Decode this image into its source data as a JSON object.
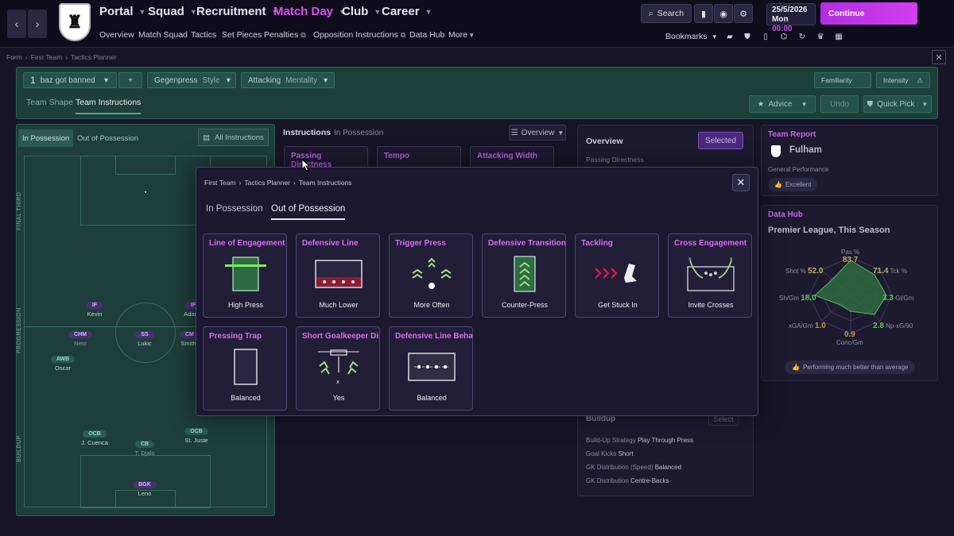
{
  "nav": {
    "menus": [
      {
        "label": "Portal"
      },
      {
        "label": "Squad"
      },
      {
        "label": "Recruitment"
      },
      {
        "label": "Match Day"
      },
      {
        "label": "Club"
      },
      {
        "label": "Career"
      }
    ],
    "submenu": [
      "Overview",
      "Match Squad",
      "Tactics",
      "Set Pieces",
      "Penalties",
      "Opposition Instructions",
      "Data Hub",
      "More"
    ],
    "search_label": "Search",
    "date": "25/5/2026",
    "day": "Mon",
    "time": "00:00",
    "continue_label": "Continue",
    "bookmarks_label": "Bookmarks"
  },
  "breadcrumb": [
    "Form",
    "First Team",
    "Tactics Planner"
  ],
  "tactics_bar": {
    "tactic_number": "1",
    "tactic_name": "baz got banned",
    "plus_label": "+",
    "in_poss_style": "Gegenpress",
    "in_poss_style_label": "Style",
    "out_poss_mentality": "Attacking",
    "out_poss_mentality_label": "Mentality",
    "familiarity_label": "Familiarity",
    "intensity_label": "Intensity",
    "tabs": [
      "Team Shape",
      "Team Instructions"
    ],
    "advice_label": "Advice",
    "undo_label": "Undo",
    "quick_pick_label": "Quick Pick"
  },
  "pitch_panel": {
    "tabs": [
      "In Possession",
      "Out of Possession"
    ],
    "all_instructions_label": "All Instructions",
    "zones": [
      "FINAL THIRD",
      "PROGRESSION",
      "BUILDUP"
    ],
    "players": [
      {
        "pos": "IF",
        "name": "Kevin"
      },
      {
        "pos": "IF",
        "name": "Adama"
      },
      {
        "pos": "CHM",
        "name": "Neto"
      },
      {
        "pos": "SS",
        "name": "Lukic"
      },
      {
        "pos": "CM",
        "name": "Smith"
      },
      {
        "pos": "AWB",
        "name": "Oscar"
      },
      {
        "pos": "OCB",
        "name": "J. Cuenca"
      },
      {
        "pos": "CB",
        "name": "T. Djalo"
      },
      {
        "pos": "OCB",
        "name": "St. Juste"
      },
      {
        "pos": "BGK",
        "name": "Leno"
      }
    ]
  },
  "instructions": {
    "title": "Instructions",
    "subtitle": "In Possession",
    "view_label": "Overview",
    "bg_cards": [
      "Passing Directness",
      "Tempo",
      "Attacking Width"
    ]
  },
  "overview_panel": {
    "title": "Overview",
    "selected_label": "Selected",
    "first_item": "Passing Directness",
    "buildup_title": "Buildup",
    "select_label": "Select",
    "items": [
      {
        "label": "Build-Up Strategy",
        "value": "Play Through Press"
      },
      {
        "label": "Goal Kicks",
        "value": "Short"
      },
      {
        "label": "GK Distribution (Speed)",
        "value": "Balanced"
      },
      {
        "label": "GK Distribution",
        "value": "Centre-Backs"
      }
    ]
  },
  "team_report": {
    "title": "Team Report",
    "team": "Fulham",
    "performance_label": "General Performance",
    "performance_value": "Excellent"
  },
  "data_hub": {
    "title": "Data Hub",
    "subtitle": "Premier League, This Season",
    "footer": "Performing much better than average",
    "metrics": [
      {
        "label": "Pas %",
        "value": "83.7",
        "color": "#b9b05a"
      },
      {
        "label": "Tck %",
        "value": "71.4",
        "color": "#b9b05a"
      },
      {
        "label": "Gl/Gm",
        "value": "3.3",
        "color": "#5fc05f"
      },
      {
        "label": "Np-xG/90",
        "value": "2.8",
        "color": "#5fc05f"
      },
      {
        "label": "Conc/Gm",
        "value": "0.9",
        "color": "#c4963c"
      },
      {
        "label": "xGA/Gm",
        "value": "1.0",
        "color": "#c4963c"
      },
      {
        "label": "Sh/Gm",
        "value": "18.0",
        "color": "#5fc05f"
      },
      {
        "label": "Shot %",
        "value": "52.0",
        "color": "#b9b05a"
      }
    ]
  },
  "modal": {
    "breadcrumb": [
      "First Team",
      "Tactics Planner",
      "Team Instructions"
    ],
    "tabs": [
      "In Possession",
      "Out of Possession"
    ],
    "cards": [
      {
        "title": "Line of Engagement",
        "value": "High Press",
        "icon": "line-of-engagement-icon"
      },
      {
        "title": "Defensive Line",
        "value": "Much Lower",
        "icon": "defensive-line-icon"
      },
      {
        "title": "Trigger Press",
        "value": "More Often",
        "icon": "trigger-press-icon"
      },
      {
        "title": "Defensive Transition",
        "value": "Counter-Press",
        "icon": "defensive-transition-icon"
      },
      {
        "title": "Tackling",
        "value": "Get Stuck In",
        "icon": "tackling-icon"
      },
      {
        "title": "Cross Engagement",
        "value": "Invite Crosses",
        "icon": "cross-engagement-icon"
      },
      {
        "title": "Pressing Trap",
        "value": "Balanced",
        "icon": "pressing-trap-icon"
      },
      {
        "title": "Short Goalkeeper Distribution",
        "value": "Yes",
        "icon": "short-goalkeeper-distribution-icon"
      },
      {
        "title": "Defensive Line Behaviour",
        "value": "Balanced",
        "icon": "defensive-line-behaviour-icon"
      }
    ]
  },
  "colors": {
    "accent": "#d23ef0",
    "card_title": "#d96cf2",
    "pitch_green": "#1d3e3a",
    "positive": "#5fc05f"
  }
}
